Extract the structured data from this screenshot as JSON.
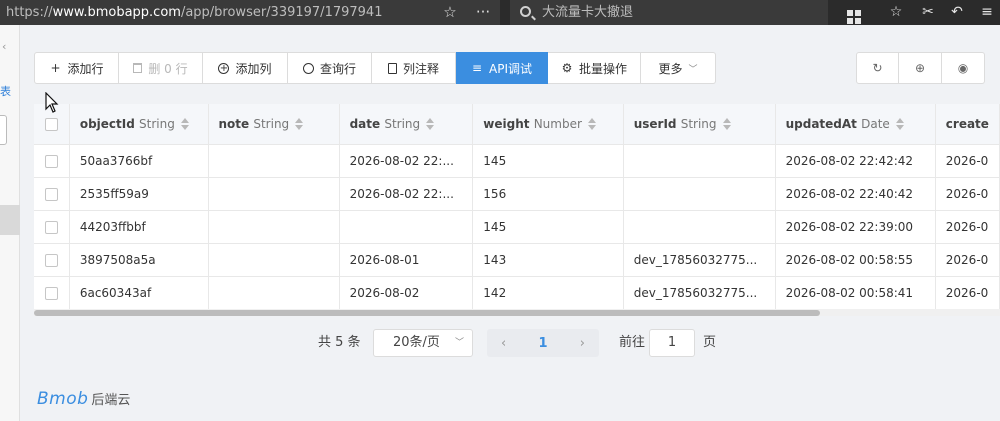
{
  "browser": {
    "url_prefix": "https://",
    "url_host": "www.bmobapp.com",
    "url_path": "/app/browser/339197/1797941",
    "search_placeholder": "大流量卡大撤退",
    "icons": [
      "star-icon",
      "more-icon",
      "grid-icon",
      "favorites-icon",
      "scissors-icon",
      "back-icon",
      "menu-icon"
    ]
  },
  "sidebar": {
    "chevron": "‹",
    "blue_label": "表"
  },
  "toolbar": {
    "add_row": "添加行",
    "delete_rows": "删 0 行",
    "add_column": "添加列",
    "query_row": "查询行",
    "column_comments": "列注释",
    "api_debug": "API调试",
    "batch_ops": "批量操作",
    "more": "更多"
  },
  "table": {
    "columns": [
      {
        "name": "objectId",
        "type": "String"
      },
      {
        "name": "note",
        "type": "String"
      },
      {
        "name": "date",
        "type": "String"
      },
      {
        "name": "weight",
        "type": "Number"
      },
      {
        "name": "userId",
        "type": "String"
      },
      {
        "name": "updatedAt",
        "type": "Date"
      },
      {
        "name": "create",
        "type": ""
      }
    ],
    "rows": [
      [
        "50aa3766bf",
        "",
        "2026-08-02 22:...",
        "145",
        "",
        "2026-08-02 22:42:42",
        "2026-0"
      ],
      [
        "2535ff59a9",
        "",
        "2026-08-02 22:...",
        "156",
        "",
        "2026-08-02 22:40:42",
        "2026-0"
      ],
      [
        "44203ffbbf",
        "",
        "",
        "145",
        "",
        "2026-08-02 22:39:00",
        "2026-0"
      ],
      [
        "3897508a5a",
        "",
        "2026-08-01",
        "143",
        "dev_17856032775...",
        "2026-08-02 00:58:55",
        "2026-0"
      ],
      [
        "6ac60343af",
        "",
        "2026-08-02",
        "142",
        "dev_17856032775...",
        "2026-08-02 00:58:41",
        "2026-0"
      ]
    ]
  },
  "pagination": {
    "total": "共 5 条",
    "page_size": "20条/页",
    "current_page": "1",
    "goto_label": "前往",
    "goto_value": "1",
    "page_suffix": "页",
    "prev": "‹",
    "next": "›"
  },
  "footer": {
    "logo": "Bmob",
    "tagline": "后端云"
  },
  "colors": {
    "primary": "#3b8ee0",
    "browser_bar": "#2b2b2b"
  }
}
